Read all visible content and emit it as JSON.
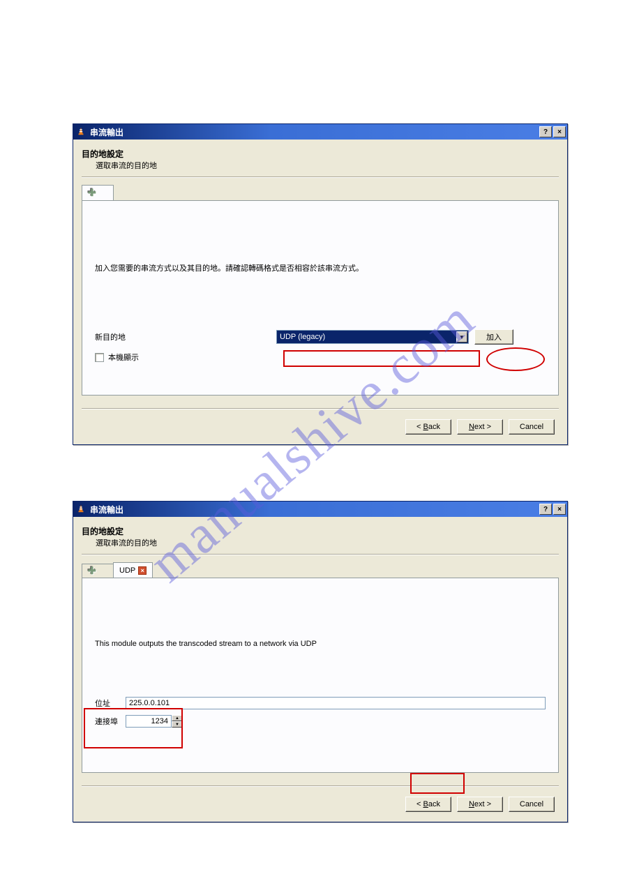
{
  "watermark": "manualshive.com",
  "dialog1": {
    "title": "串流輸出",
    "heading": "目的地設定",
    "subheading": "選取串流的目的地",
    "panel_text": "加入您需要的串流方式以及其目的地。請確認轉碼格式是否相容於該串流方式。",
    "new_dest_label": "新目的地",
    "dropdown_value": "UDP (legacy)",
    "add_button": "加入",
    "checkbox_label": "本機顯示",
    "back_btn": "< Back",
    "next_btn": "Next >",
    "cancel_btn": "Cancel"
  },
  "dialog2": {
    "title": "串流輸出",
    "heading": "目的地設定",
    "subheading": "選取串流的目的地",
    "tab_udp": "UDP",
    "panel_text": "This module outputs the transcoded stream to a network via UDP",
    "addr_label": "位址",
    "addr_value": "225.0.0.101",
    "port_label": "連接埠",
    "port_value": "1234",
    "back_btn": "< Back",
    "next_btn": "Next >",
    "cancel_btn": "Cancel"
  }
}
